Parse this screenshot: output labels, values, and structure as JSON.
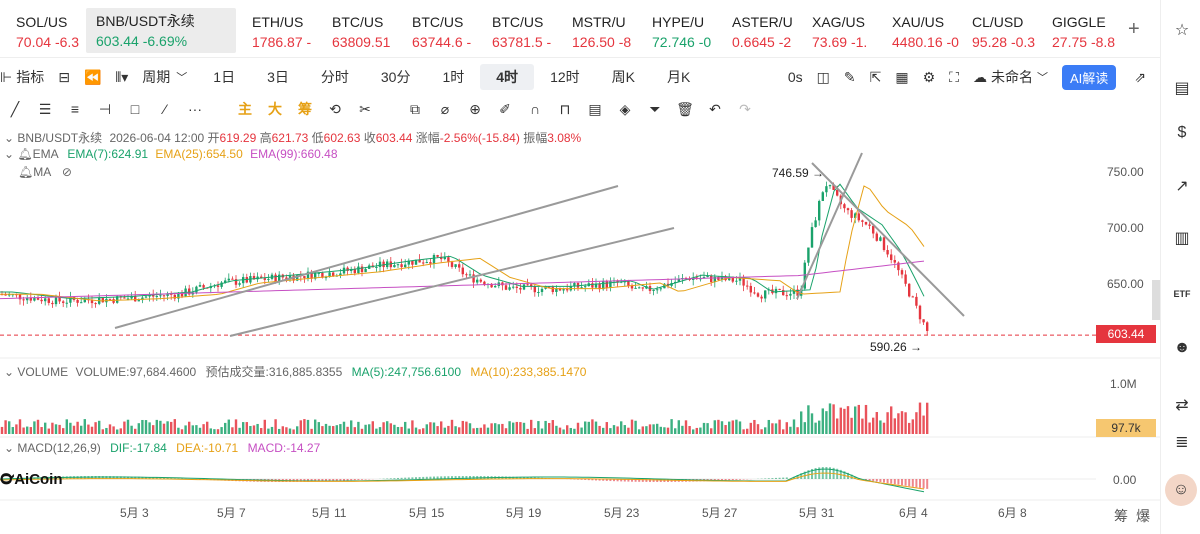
{
  "tickers": [
    {
      "symbol": "SOL/US",
      "price": "70.04",
      "change": "-6.3",
      "dir": "dn"
    },
    {
      "symbol": "BNB/USDT永续",
      "price": "603.44",
      "change": "-6.69%",
      "dir": "up",
      "active": true
    },
    {
      "symbol": "ETH/US",
      "price": "1786.87",
      "change": "-",
      "dir": "dn"
    },
    {
      "symbol": "BTC/US",
      "price": "63809.51",
      "change": "",
      "dir": "none"
    },
    {
      "symbol": "BTC/US",
      "price": "63744.6",
      "change": "-",
      "dir": "dn"
    },
    {
      "symbol": "BTC/US",
      "price": "63781.5",
      "change": "-",
      "dir": "none"
    },
    {
      "symbol": "MSTR/U",
      "price": "126.50",
      "change": "-8",
      "dir": "dn"
    },
    {
      "symbol": "HYPE/U",
      "price": "72.746",
      "change": "-0",
      "dir": "up"
    },
    {
      "symbol": "ASTER/U",
      "price": "0.6645",
      "change": "-2",
      "dir": "dn"
    },
    {
      "symbol": "XAG/US",
      "price": "73.69",
      "change": "-1.",
      "dir": "dn"
    },
    {
      "symbol": "XAU/US",
      "price": "4480.16",
      "change": "-0",
      "dir": "none"
    },
    {
      "symbol": "CL/USD",
      "price": "95.28",
      "change": "-0.3",
      "dir": "none"
    },
    {
      "symbol": "GIGGLE",
      "price": "27.75",
      "change": "-8.8",
      "dir": "none"
    }
  ],
  "plus_label": "+",
  "toolbar": {
    "indicator": "指标",
    "period": "周期",
    "periods": [
      "1日",
      "3日",
      "分时",
      "30分",
      "1时",
      "4时",
      "12时",
      "周K",
      "月K"
    ],
    "selected_period": "4时",
    "zero_s": "0s",
    "unnamed": "未命名",
    "ai_label": "AI解读"
  },
  "draw_tools": {
    "zhu": "主",
    "da": "大",
    "chou": "筹"
  },
  "info": {
    "symbol": "BNB/USDT永续",
    "datetime": "2026-06-04 12:00",
    "open_label": "开",
    "open": "619.29",
    "high_label": "高",
    "high": "621.73",
    "low_label": "低",
    "low": "602.63",
    "close_label": "收",
    "close": "603.44",
    "chg_label": "涨幅",
    "chg": "-2.56%(-15.84)",
    "amp_label": "振幅",
    "amp": "3.08%",
    "ema_label": "EMA",
    "ema7": "EMA(7):624.91",
    "ema25": "EMA(25):654.50",
    "ema99": "EMA(99):660.48",
    "ma_label": "MA"
  },
  "volume": {
    "label": "VOLUME",
    "value": "VOLUME:97,684.4600",
    "est": "预估成交量:316,885.8355",
    "ma5": "MA(5):247,756.6100",
    "ma10": "MA(10):233,385.1470",
    "axis_top": "1.0M",
    "badge": "97.7k"
  },
  "macd": {
    "label": "MACD(12,26,9)",
    "dif": "DIF:-17.84",
    "dea": "DEA:-10.71",
    "macd": "MACD:-14.27",
    "axis_zero": "0.00"
  },
  "price_axis": [
    "750.00",
    "700.00",
    "650.00"
  ],
  "price_badge": "603.44",
  "annotations": {
    "high": "746.59",
    "low": "590.26",
    "high_arrow": "→",
    "low_arrow": "→"
  },
  "dates": [
    "5月 3",
    "5月 7",
    "5月 11",
    "5月 15",
    "5月 19",
    "5月 23",
    "5月 27",
    "5月 31",
    "6月 4",
    "6月 8"
  ],
  "right_labels": {
    "chou": "筹",
    "bao": "爆"
  },
  "logo": "AiCoin",
  "colors": {
    "up": "#1aa26b",
    "down": "#e5353e",
    "ema7": "#1aa26b",
    "ema25": "#e6a116",
    "ema99": "#c64fc3",
    "price_line": "#e5353e",
    "accent": "#3b7cf6"
  }
}
